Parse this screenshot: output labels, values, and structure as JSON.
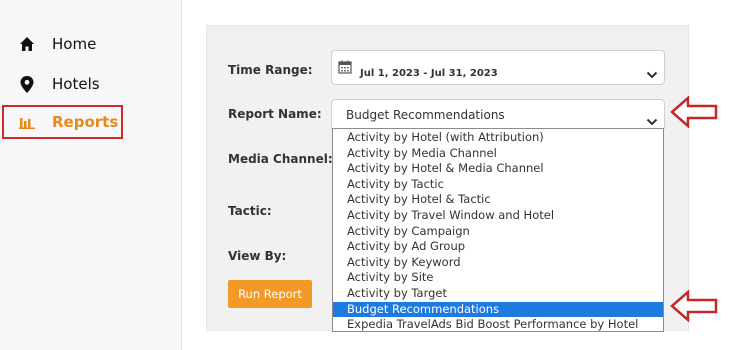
{
  "sidebar": {
    "items": [
      {
        "label": "Home",
        "icon": "home-icon"
      },
      {
        "label": "Hotels",
        "icon": "location-pin-icon"
      },
      {
        "label": "Reports",
        "icon": "bar-chart-icon",
        "active": true
      }
    ]
  },
  "form": {
    "time_range": {
      "label": "Time Range:",
      "value": "Jul 1, 2023 - Jul 31, 2023"
    },
    "report_name": {
      "label": "Report Name:",
      "value": "Budget Recommendations",
      "options": [
        "Activity by Hotel (with Attribution)",
        "Activity by Media Channel",
        "Activity by Hotel & Media Channel",
        "Activity by Tactic",
        "Activity by Hotel & Tactic",
        "Activity by Travel Window and Hotel",
        "Activity by Campaign",
        "Activity by Ad Group",
        "Activity by Keyword",
        "Activity by Site",
        "Activity by Target",
        "Budget Recommendations",
        "Expedia TravelAds Bid Boost Performance by Hotel"
      ],
      "selected_index": 11
    },
    "media_channel": {
      "label": "Media Channel:"
    },
    "tactic": {
      "label": "Tactic:"
    },
    "view_by": {
      "label": "View By:"
    },
    "run_button": "Run Report"
  },
  "colors": {
    "accent": "#f39a26",
    "active_nav": "#e88a1a",
    "highlight_border": "#cf2b2b",
    "selected_option": "#1f7ae0"
  }
}
